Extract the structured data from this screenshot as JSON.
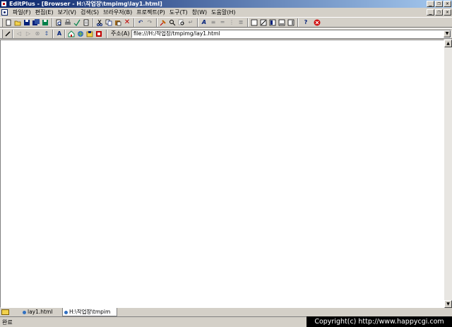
{
  "window": {
    "title": "EditPlus - [Browser - H:\\작업장\\tmpimg\\lay1.html]",
    "buttons": {
      "minimize": "_",
      "restore": "❐",
      "close": "✕"
    }
  },
  "menu": [
    "파일(F)",
    "편집(E)",
    "보기(V)",
    "검색(S)",
    "브라우저(B)",
    "프로젝트(P)",
    "도구(T)",
    "창(W)",
    "도움말(H)"
  ],
  "toolbar1": {
    "icons": [
      "new-icon",
      "open-icon",
      "save-icon",
      "save-all-icon",
      "print-icon",
      "print-preview-icon",
      "spell-check-icon",
      "cut-icon",
      "copy-icon",
      "paste-icon",
      "delete-icon",
      "undo-icon",
      "redo-icon",
      "find-icon",
      "replace-icon",
      "go-to-icon",
      "font-icon",
      "word-wrap-icon",
      "ruler-icon",
      "column-select-icon",
      "fullscreen-icon",
      "window-icon",
      "help-icon",
      "stop-icon"
    ]
  },
  "toolbar2": {
    "address_label": "주소(A)",
    "address_value": "file:///H:/작업장/tmpimg/lay1.html"
  },
  "tabs": [
    {
      "label": "lay1.html",
      "active": false
    },
    {
      "label": "H:\\작업장\\tmpim",
      "active": true
    }
  ],
  "status": {
    "text": "완료"
  },
  "watermark": "Copyright(c) http://www.happycgi.com"
}
